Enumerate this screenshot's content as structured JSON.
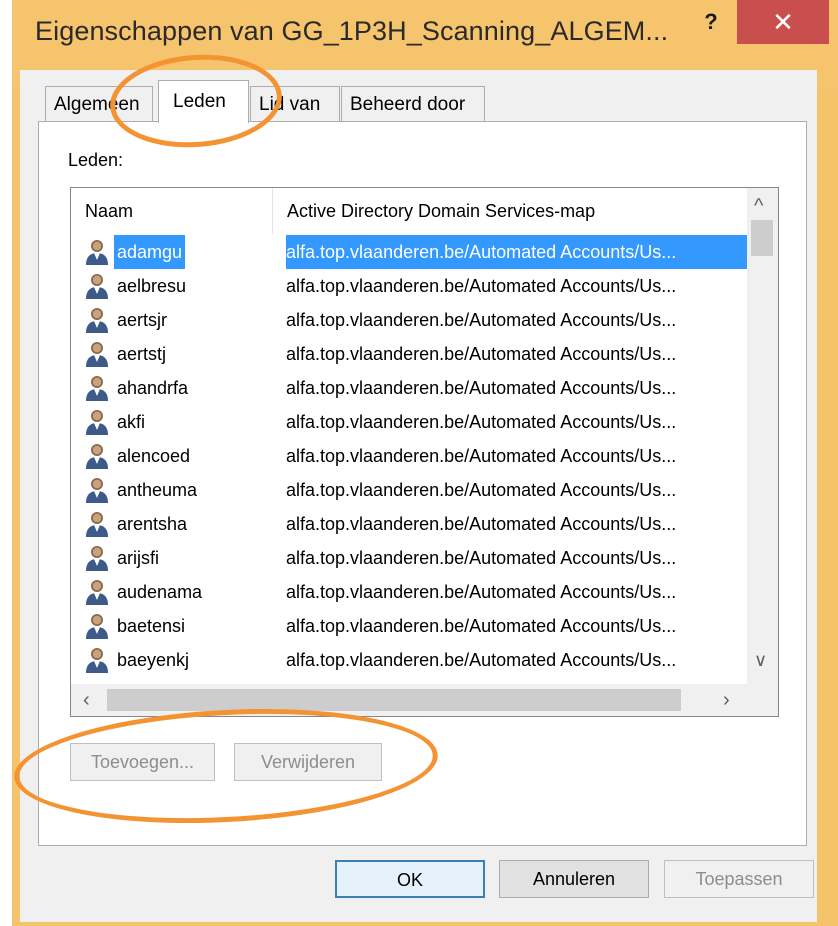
{
  "window": {
    "title": "Eigenschappen van GG_1P3H_Scanning_ALGEM...",
    "help_label": "?",
    "close_label": "✕"
  },
  "tabs": [
    {
      "label": "Algemeen",
      "active": false
    },
    {
      "label": "Leden",
      "active": true
    },
    {
      "label": "Lid van",
      "active": false
    },
    {
      "label": "Beheerd door",
      "active": false
    }
  ],
  "members": {
    "label": "Leden:",
    "columns": [
      "Naam",
      "Active Directory Domain Services-map"
    ],
    "rows": [
      {
        "name": "adamgu",
        "path": "alfa.top.vlaanderen.be/Automated Accounts/Us...",
        "selected": true
      },
      {
        "name": "aelbresu",
        "path": "alfa.top.vlaanderen.be/Automated Accounts/Us...",
        "selected": false
      },
      {
        "name": "aertsjr",
        "path": "alfa.top.vlaanderen.be/Automated Accounts/Us...",
        "selected": false
      },
      {
        "name": "aertstj",
        "path": "alfa.top.vlaanderen.be/Automated Accounts/Us...",
        "selected": false
      },
      {
        "name": "ahandrfa",
        "path": "alfa.top.vlaanderen.be/Automated Accounts/Us...",
        "selected": false
      },
      {
        "name": "akfi",
        "path": "alfa.top.vlaanderen.be/Automated Accounts/Us...",
        "selected": false
      },
      {
        "name": "alencoed",
        "path": "alfa.top.vlaanderen.be/Automated Accounts/Us...",
        "selected": false
      },
      {
        "name": "antheuma",
        "path": "alfa.top.vlaanderen.be/Automated Accounts/Us...",
        "selected": false
      },
      {
        "name": "arentsha",
        "path": "alfa.top.vlaanderen.be/Automated Accounts/Us...",
        "selected": false
      },
      {
        "name": "arijsfi",
        "path": "alfa.top.vlaanderen.be/Automated Accounts/Us...",
        "selected": false
      },
      {
        "name": "audenama",
        "path": "alfa.top.vlaanderen.be/Automated Accounts/Us...",
        "selected": false
      },
      {
        "name": "baetensi",
        "path": "alfa.top.vlaanderen.be/Automated Accounts/Us...",
        "selected": false
      },
      {
        "name": "baeyenkj",
        "path": "alfa.top.vlaanderen.be/Automated Accounts/Us...",
        "selected": false
      }
    ]
  },
  "actions": {
    "add_label": "Toevoegen...",
    "remove_label": "Verwijderen"
  },
  "footer": {
    "ok_label": "OK",
    "cancel_label": "Annuleren",
    "apply_label": "Toepassen"
  },
  "colors": {
    "titlebar": "#f6c46c",
    "close_button": "#c94f4f",
    "selection": "#3399ff",
    "annotation": "#f39332"
  },
  "icons": {
    "user": "user-icon",
    "scroll_up": "chevron-up-icon",
    "scroll_down": "chevron-down-icon",
    "scroll_left": "chevron-left-icon",
    "scroll_right": "chevron-right-icon"
  }
}
